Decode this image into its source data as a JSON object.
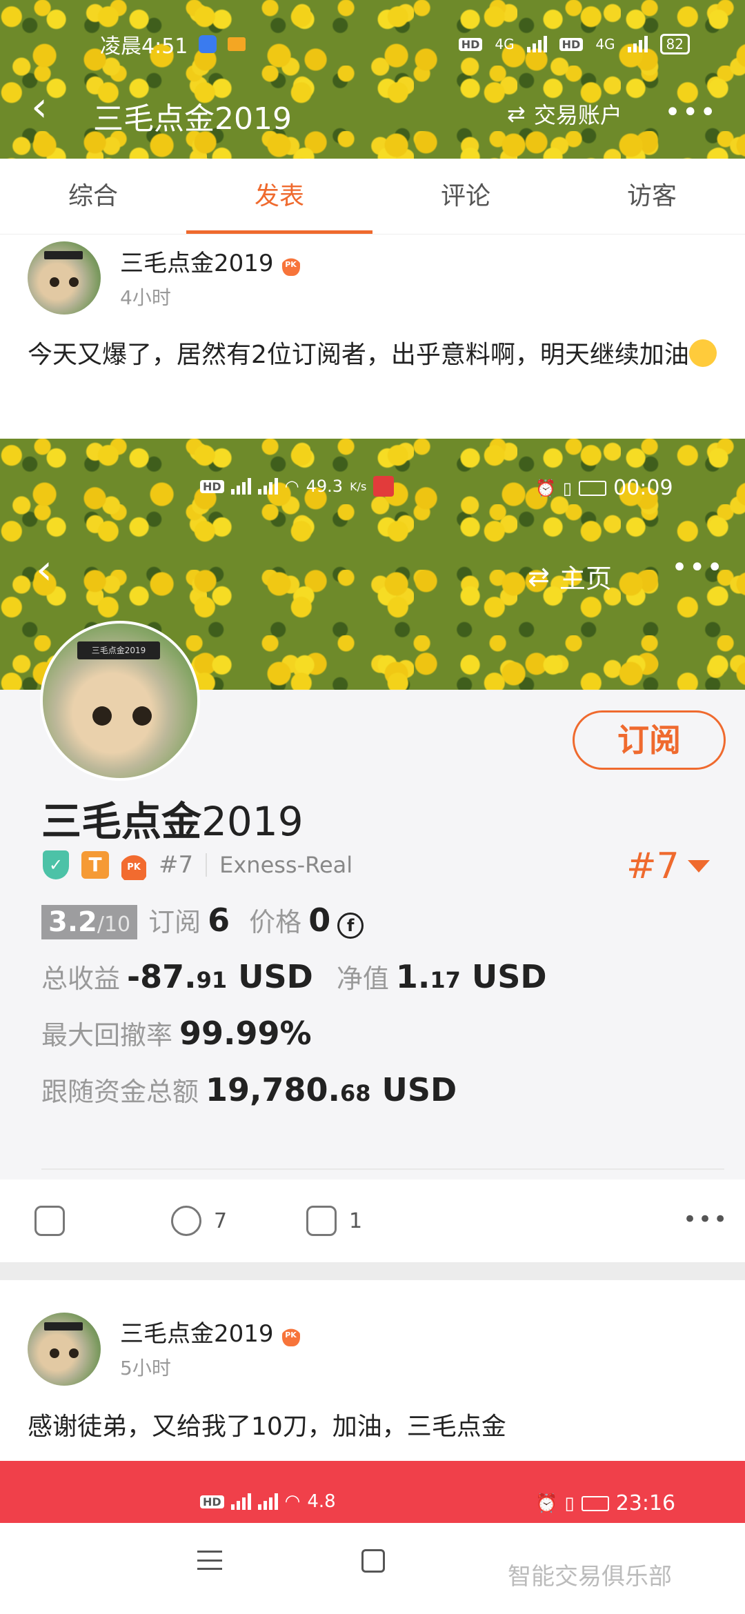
{
  "status_bar": {
    "time": "凌晨4:51",
    "hd1": "HD",
    "net1": "4G",
    "hd2": "HD",
    "net2": "4G",
    "battery": "82"
  },
  "header": {
    "title": "三毛点金2019",
    "account_label": "交易账户"
  },
  "tabs": [
    {
      "label": "综合"
    },
    {
      "label": "发表"
    },
    {
      "label": "评论"
    },
    {
      "label": "访客"
    }
  ],
  "post1": {
    "author": "三毛点金2019",
    "badge": "PK",
    "time": "4小时",
    "text": "今天又爆了，居然有2位订阅者，出乎意料啊，明天继续加油"
  },
  "embedded": {
    "status": {
      "speed": "49.3",
      "speed_unit": "K/s",
      "time": "00:09"
    },
    "home_label": "主页",
    "avatar_tag": "三毛点金2019",
    "subscribe_label": "订阅",
    "name_cn": "三毛点金",
    "name_num": "2019",
    "rank_small": "#7",
    "broker": "Exness-Real",
    "rank_big": "#7",
    "score": "3.2",
    "score_max": "/10",
    "subscribe_count_label": "订阅",
    "subscribe_count": "6",
    "price_label": "价格",
    "price": "0",
    "total_profit_label": "总收益",
    "total_profit_main": "-87.",
    "total_profit_dec": "91",
    "total_profit_unit": "USD",
    "net_value_label": "净值",
    "net_value_main": "1.",
    "net_value_dec": "17",
    "net_value_unit": "USD",
    "max_drawdown_label": "最大回撤率",
    "max_drawdown": "99.99%",
    "follow_funds_label": "跟随资金总额",
    "follow_funds_main": "19,780.",
    "follow_funds_dec": "68",
    "follow_funds_unit": "USD"
  },
  "actions": {
    "comments": "7",
    "likes": "1"
  },
  "post2": {
    "author": "三毛点金2019",
    "badge": "PK",
    "time": "5小时",
    "text": "感谢徒弟，又给我了10刀，加油，三毛点金"
  },
  "red_strip": {
    "speed": "4.8",
    "time": "23:16"
  },
  "watermark": "智能交易俱乐部"
}
